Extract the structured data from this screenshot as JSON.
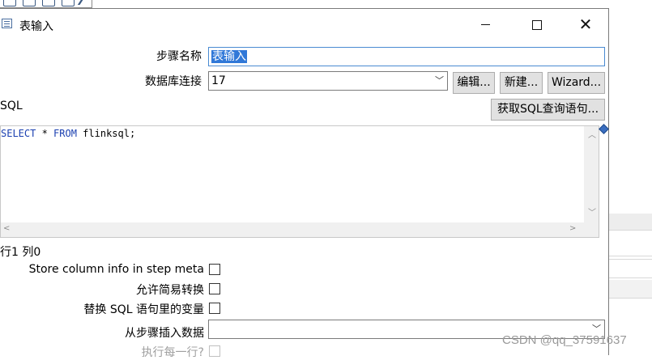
{
  "dialog": {
    "title": "表输入",
    "controls": {
      "minimize_icon": "minimize-icon",
      "maximize_icon": "maximize-icon",
      "close_icon": "close-icon"
    }
  },
  "form": {
    "step_name_label": "步骤名称",
    "step_name_value": "表输入",
    "db_connection_label": "数据库连接",
    "db_connection_value": "17",
    "edit_button": "编辑...",
    "new_button": "新建...",
    "wizard_button": "Wizard...",
    "sql_label": "SQL",
    "get_sql_button": "获取SQL查询语句...",
    "sql_text": {
      "keyword1": "SELECT",
      "op": " * ",
      "keyword2": "FROM",
      "rest": " flinksql;"
    },
    "cursor_position": "行1 列0",
    "store_column_info_label": "Store column info in step meta",
    "store_column_info_checked": false,
    "lazy_conversion_label": "允许简易转换",
    "lazy_conversion_checked": false,
    "replace_variables_label": "替换 SQL 语句里的变量",
    "replace_variables_checked": false,
    "insert_from_step_label": "从步骤插入数据",
    "insert_from_step_value": "",
    "execute_each_row_label": "执行每一行?",
    "execute_each_row_checked": false
  },
  "watermark": "CSDN @qq_37591637",
  "colors": {
    "selection": "#3078d8",
    "keyword": "#1a3fb0",
    "button_bg": "#e1e1e1"
  }
}
